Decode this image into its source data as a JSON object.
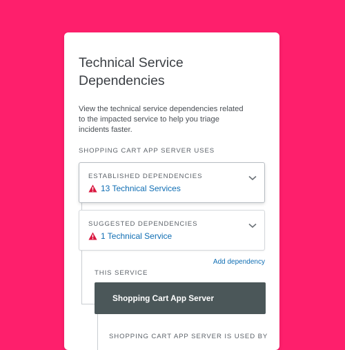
{
  "panel": {
    "title": "Technical Service Dependencies",
    "description": "View the technical service dependencies related to the impacted service to help you triage incidents faster.",
    "uses_label": "SHOPPING CART APP SERVER USES",
    "established": {
      "heading": "ESTABLISHED DEPENDENCIES",
      "count_text": "13 Technical Services"
    },
    "suggested": {
      "heading": "SUGGESTED DEPENDENCIES",
      "count_text": "1 Technical Service"
    },
    "add_dependency_label": "Add dependency",
    "this_service_label": "THIS SERVICE",
    "service_name": "Shopping Cart App Server",
    "used_by_label": "SHOPPING CART APP SERVER IS USED BY"
  },
  "colors": {
    "background": "#fe1f6c",
    "link": "#0e6db3",
    "warning": "#d9163e",
    "service_box": "#4b5759"
  },
  "icons": {
    "warning": "warning-triangle-icon",
    "expand": "chevron-down-icon"
  }
}
